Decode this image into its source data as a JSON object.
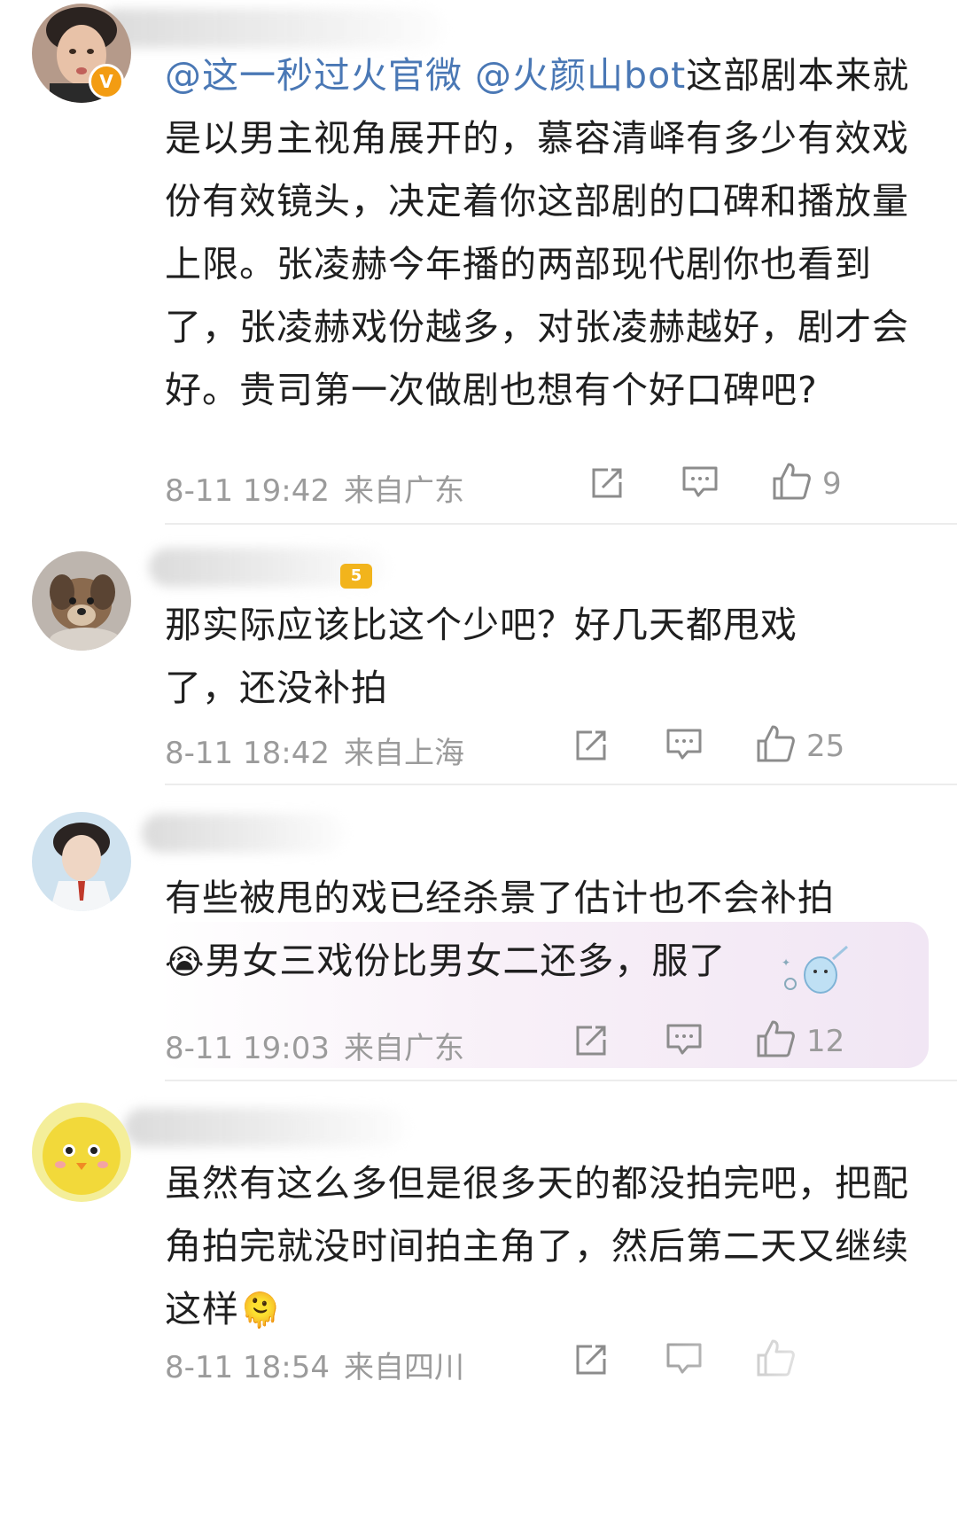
{
  "comments": [
    {
      "body_parts": [
        {
          "text": "@这一秒过火官微",
          "type": "mention"
        },
        {
          "text": " ",
          "type": "text"
        },
        {
          "text": "@火颜山bot",
          "type": "mention"
        },
        {
          "text": "这部剧本来就是以男主视角展开的，慕容清峄有多少有效戏份有效镜头，决定着你这部剧的口碑和播放量上限。张凌赫今年播的两部现代剧你也看到了，张凌赫戏份越多，对张凌赫越好，剧才会好。贵司第一次做剧也想有个好口碑吧?",
          "type": "text"
        }
      ],
      "date": "8-11 19:42",
      "location": "来自广东",
      "likes": "9",
      "verified_badge": "V"
    },
    {
      "body": "那实际应该比这个少吧？好几天都甩戏了，还没补拍",
      "date": "8-11 18:42",
      "location": "来自上海",
      "likes": "25",
      "level_badge": "5"
    },
    {
      "body_line1": "有些被甩的戏已经杀景了估计也不会补拍",
      "body_line2": "男女三戏份比男女二还多，服了",
      "emoji": "😭",
      "date": "8-11 19:03",
      "location": "来自广东",
      "likes": "12"
    },
    {
      "body": "虽然有这么多但是很多天的都没拍完吧，把配角拍完就没时间拍主角了，然后第二天又继续这样",
      "emoji": "🫠",
      "date": "8-11 18:54",
      "location": "来自四川"
    }
  ],
  "icons": {
    "share": "share-icon",
    "comment": "comment-icon",
    "like": "thumbs-up-icon"
  },
  "colors": {
    "mention": "#4a78b5",
    "meta": "#9b9b9b",
    "verified": "#f39c12"
  }
}
